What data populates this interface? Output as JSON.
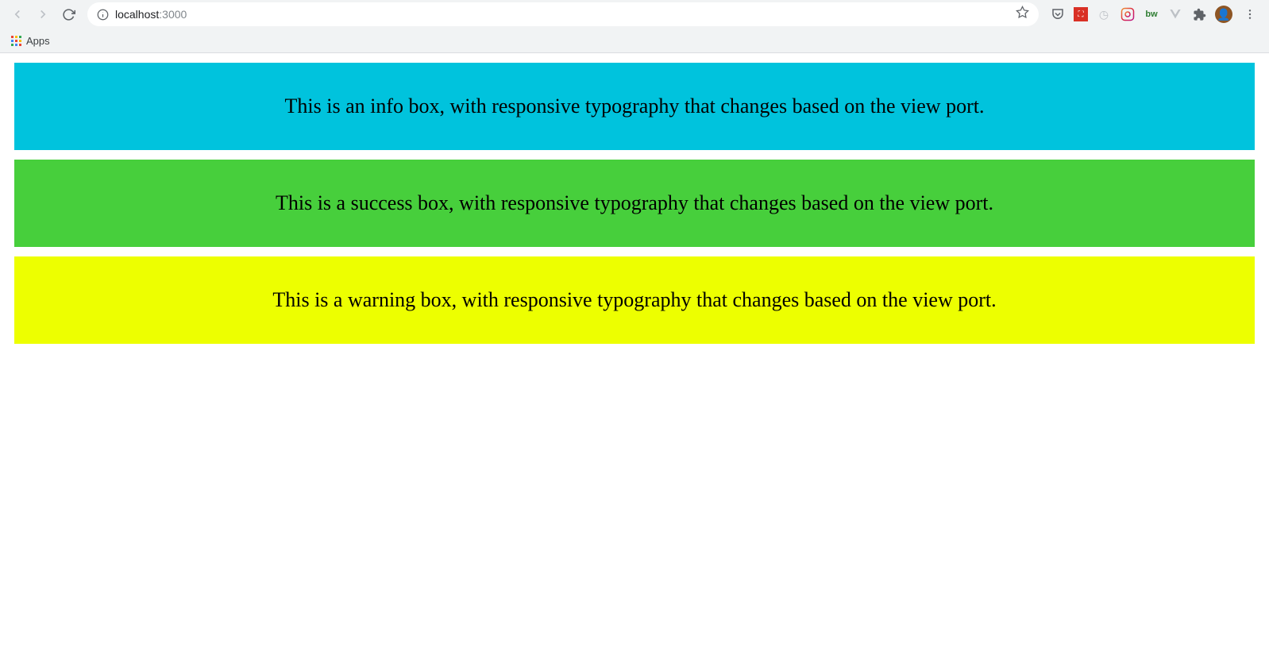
{
  "browser": {
    "url_host": "localhost",
    "url_port": ":3000",
    "bookmarks": {
      "apps_label": "Apps"
    }
  },
  "page": {
    "boxes": [
      {
        "type": "info",
        "text": "This is an info box, with responsive typography that changes based on the view port."
      },
      {
        "type": "success",
        "text": "This is a success box, with responsive typography that changes based on the view port."
      },
      {
        "type": "warning",
        "text": "This is a warning box, with responsive typography that changes based on the view port."
      }
    ],
    "colors": {
      "info": "#00c3dd",
      "success": "#47cf3c",
      "warning": "#edff00"
    }
  }
}
